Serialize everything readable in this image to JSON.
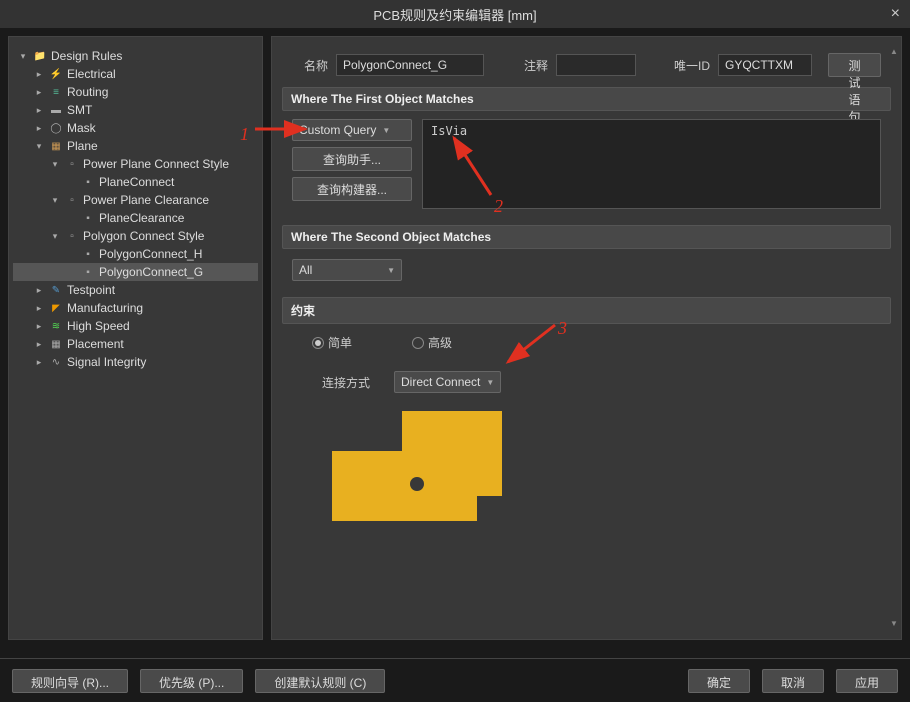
{
  "window": {
    "title": "PCB规则及约束编辑器 [mm]",
    "close": "×"
  },
  "tree": {
    "root": "Design Rules",
    "electrical": "Electrical",
    "routing": "Routing",
    "smt": "SMT",
    "mask": "Mask",
    "plane": "Plane",
    "powerPlaneConnect": "Power Plane Connect Style",
    "planeConnect": "PlaneConnect",
    "powerPlaneClearance": "Power Plane Clearance",
    "planeClearance": "PlaneClearance",
    "polygonConnect": "Polygon Connect Style",
    "polygonConnectH": "PolygonConnect_H",
    "polygonConnectG": "PolygonConnect_G",
    "testpoint": "Testpoint",
    "manufacturing": "Manufacturing",
    "highSpeed": "High Speed",
    "placement": "Placement",
    "signalIntegrity": "Signal Integrity"
  },
  "form": {
    "nameLabel": "名称",
    "nameValue": "PolygonConnect_G",
    "commentLabel": "注释",
    "commentValue": "",
    "idLabel": "唯一ID",
    "idValue": "GYQCTTXM",
    "testBtn": "测试语句"
  },
  "section1": {
    "header": "Where The First Object Matches",
    "dropdown": "Custom Query",
    "queryValue": "IsVia",
    "helperBtn": "查询助手...",
    "builderBtn": "查询构建器..."
  },
  "section2": {
    "header": "Where The Second Object Matches",
    "dropdown": "All"
  },
  "section3": {
    "header": "约束",
    "radioSimple": "简单",
    "radioAdvanced": "高级",
    "connectLabel": "连接方式",
    "connectValue": "Direct Connect"
  },
  "footer": {
    "wizard": "规则向导 (R)...",
    "priority": "优先级 (P)...",
    "createDefault": "创建默认规则 (C)",
    "ok": "确定",
    "cancel": "取消",
    "apply": "应用"
  },
  "annotations": {
    "a1": "1",
    "a2": "2",
    "a3": "3"
  },
  "chart_data": {
    "type": "shape-preview",
    "description": "PCB polygon direct-connect illustration: yellow L-shaped polygon with a single via hole",
    "color": "#e8b020",
    "via_position": "approx center-bottom",
    "connect_style": "Direct Connect"
  }
}
